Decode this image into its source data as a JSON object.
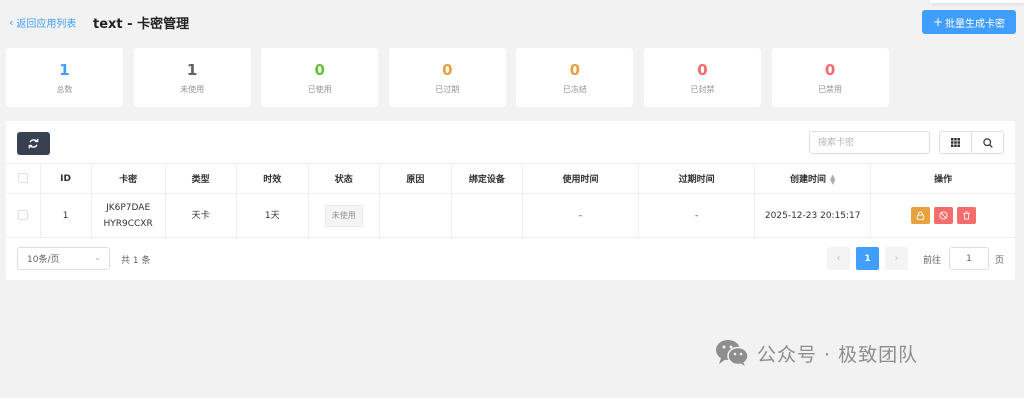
{
  "header": {
    "back_label": "返回应用列表",
    "title": "text - 卡密管理",
    "batch_button": "批量生成卡密"
  },
  "stats": [
    {
      "value": "1",
      "label": "总数",
      "color": "#409eff"
    },
    {
      "value": "1",
      "label": "未使用",
      "color": "#606266"
    },
    {
      "value": "0",
      "label": "已使用",
      "color": "#67c23a"
    },
    {
      "value": "0",
      "label": "已过期",
      "color": "#e6a23c"
    },
    {
      "value": "0",
      "label": "已冻结",
      "color": "#e6a23c"
    },
    {
      "value": "0",
      "label": "已封禁",
      "color": "#f56c6c"
    },
    {
      "value": "0",
      "label": "已禁用",
      "color": "#f56c6c"
    }
  ],
  "toolbar": {
    "search_placeholder": "搜索卡密"
  },
  "table": {
    "columns": [
      "ID",
      "卡密",
      "类型",
      "时效",
      "状态",
      "原因",
      "绑定设备",
      "使用时间",
      "过期时间",
      "创建时间",
      "操作"
    ],
    "rows": [
      {
        "id": "1",
        "card_line1": "JK6P7DAE",
        "card_line2": "HYR9CCXR",
        "type": "天卡",
        "duration": "1天",
        "status": "未使用",
        "reason": "",
        "device": "",
        "used_time": "-",
        "expire_time": "-",
        "created_time": "2025-12-23 20:15:17"
      }
    ]
  },
  "pagination": {
    "page_size": "10条/页",
    "total": "共 1 条",
    "current_page": "1",
    "goto_label": "前往",
    "goto_value": "1",
    "page_unit": "页"
  },
  "watermark": {
    "text": "公众号 · 极致团队"
  },
  "colors": {
    "primary": "#409eff",
    "warning": "#e6a23c",
    "danger": "#f56c6c",
    "success": "#67c23a",
    "dark_button": "#374151"
  }
}
